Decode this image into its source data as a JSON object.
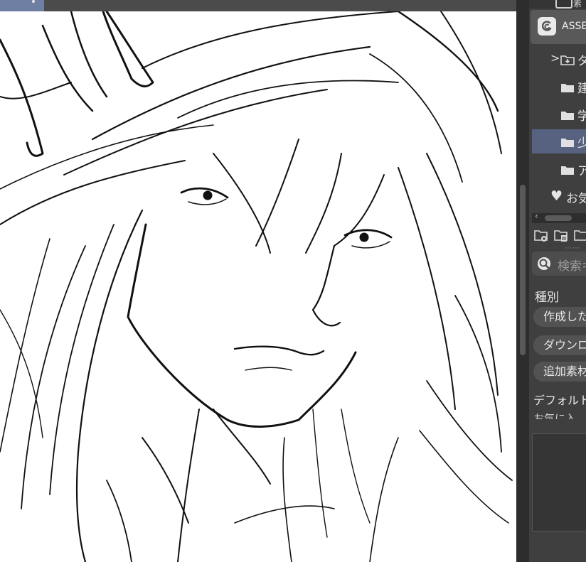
{
  "panel": {
    "top_label": "素",
    "asset_label": "ASSE",
    "tree": [
      {
        "label": "ダ",
        "icon": "folder-download-icon",
        "expandable": true
      },
      {
        "label": "建",
        "icon": "folder-icon"
      },
      {
        "label": "学",
        "icon": "folder-icon"
      },
      {
        "label": "少",
        "icon": "folder-icon",
        "selected": true
      },
      {
        "label": "ア",
        "icon": "folder-icon"
      }
    ],
    "favorites_label": "お気",
    "search_placeholder": "検索キ",
    "kind_label": "種別",
    "chips": [
      "作成した",
      "ダウンロー",
      "追加素材"
    ],
    "default_label": "デフォルトタ",
    "cut_row_label": "お気に入"
  },
  "colors": {
    "canvas_bg": "#ffffff",
    "panel_bg": "#3f3f3f",
    "selected_row": "#56627f",
    "top_tab": "#6e7fa3"
  }
}
